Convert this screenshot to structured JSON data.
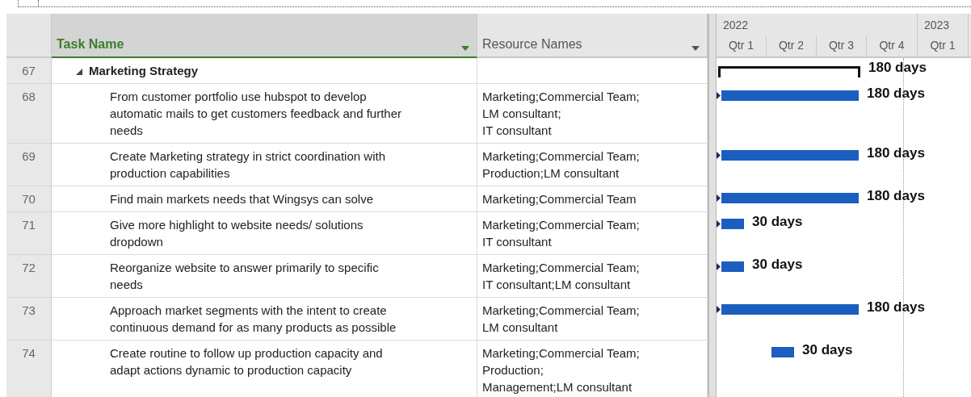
{
  "columns": [
    {
      "label": "Task Name",
      "selected": true
    },
    {
      "label": "Resource Names",
      "selected": false
    }
  ],
  "timescale": {
    "years": [
      {
        "label": "2022",
        "quarters": [
          "Qtr 1",
          "Qtr 2",
          "Qtr 3",
          "Qtr 4"
        ]
      },
      {
        "label": "2023",
        "quarters": [
          "Qtr 1"
        ]
      }
    ]
  },
  "rows": [
    {
      "id": "67",
      "kind": "summary",
      "expanded": true,
      "task": [
        "Marketing Strategy"
      ],
      "resources": [],
      "bar": {
        "kind": "long",
        "linked": false,
        "duration": "180 days"
      }
    },
    {
      "id": "68",
      "kind": "task",
      "task": [
        "From customer portfolio use hubspot to develop",
        "automatic mails to get customers feedback and further",
        "needs"
      ],
      "resources": [
        "Marketing;Commercial Team;",
        "LM consultant;",
        "IT consultant"
      ],
      "bar": {
        "kind": "long",
        "linked": true,
        "duration": "180 days"
      }
    },
    {
      "id": "69",
      "kind": "task",
      "task": [
        "Create Marketing strategy in strict coordination with",
        "production capabilities"
      ],
      "resources": [
        "Marketing;Commercial Team;",
        "Production;LM consultant"
      ],
      "bar": {
        "kind": "long",
        "linked": true,
        "duration": "180 days"
      }
    },
    {
      "id": "70",
      "kind": "task",
      "task": [
        "Find main markets needs that Wingsys can solve"
      ],
      "resources": [
        "Marketing;Commercial Team"
      ],
      "bar": {
        "kind": "long",
        "linked": true,
        "duration": "180 days"
      }
    },
    {
      "id": "71",
      "kind": "task",
      "task": [
        "Give more highlight to website needs/ solutions",
        "dropdown"
      ],
      "resources": [
        "Marketing;Commercial Team;",
        "IT consultant"
      ],
      "bar": {
        "kind": "short",
        "linked": true,
        "duration": "30 days"
      }
    },
    {
      "id": "72",
      "kind": "task",
      "task": [
        "Reorganize website to answer primarily to specific",
        "needs"
      ],
      "resources": [
        "Marketing;Commercial Team;",
        "IT consultant;LM consultant"
      ],
      "bar": {
        "kind": "short",
        "linked": true,
        "duration": "30 days"
      }
    },
    {
      "id": "73",
      "kind": "task",
      "task": [
        "Approach market segments with the intent to create",
        "continuous demand for as many products as possible"
      ],
      "resources": [
        "Marketing;Commercial Team;",
        "LM consultant"
      ],
      "bar": {
        "kind": "long",
        "linked": true,
        "duration": "180 days"
      }
    },
    {
      "id": "74",
      "kind": "task",
      "task": [
        "Create routine to follow up production capacity and",
        "adapt actions dynamic to production capacity"
      ],
      "resources": [
        "Marketing;Commercial Team;",
        "Production;",
        "Management;LM consultant"
      ],
      "bar": {
        "kind": "short_lagged",
        "linked": false,
        "duration": "30 days"
      }
    }
  ]
}
